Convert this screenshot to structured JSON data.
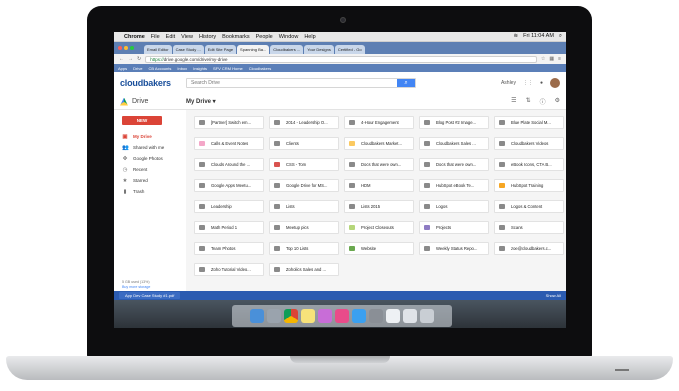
{
  "menubar": {
    "app": "Chrome",
    "items": [
      "File",
      "Edit",
      "View",
      "History",
      "Bookmarks",
      "People",
      "Window",
      "Help"
    ],
    "clock": "Fri 11:04 AM"
  },
  "tabs": [
    "Email Editor",
    "Case Study ...",
    "Edit Site Page",
    "Spanning Ba...",
    "Cloudbakers ...",
    "Your Designs",
    "Certified - Go"
  ],
  "address": {
    "scheme": "https://",
    "path": "drive.google.com/drive/my-drive"
  },
  "bookmarks": [
    "Apps",
    "Drive",
    "CB Accounts",
    "Inbox",
    "Insights",
    "SFV CRM Home",
    "Cloudbakers"
  ],
  "header": {
    "logo": "cloudbakers",
    "search_placeholder": "Search Drive",
    "account": "Ashley"
  },
  "subheader": {
    "product": "Drive",
    "location": "My Drive ▾"
  },
  "sidebar": {
    "new_label": "NEW",
    "items": [
      {
        "label": "My Drive",
        "icon": "drive-folder-icon"
      },
      {
        "label": "Shared with me",
        "icon": "people-icon"
      },
      {
        "label": "Google Photos",
        "icon": "pinwheel-icon"
      },
      {
        "label": "Recent",
        "icon": "clock-icon"
      },
      {
        "label": "Starred",
        "icon": "star-icon"
      },
      {
        "label": "Trash",
        "icon": "trash-icon"
      }
    ],
    "storage_used": "5 GB used (13%)",
    "storage_link": "Buy more storage"
  },
  "folders": [
    {
      "name": "[Partner] Switch em...",
      "color": "#8a8a8a"
    },
    {
      "name": "2014 - Leadership O...",
      "color": "#8a8a8a"
    },
    {
      "name": "4-Hour Engagement",
      "color": "#8a8a8a"
    },
    {
      "name": "Blog Post #2 Image...",
      "color": "#8a8a8a"
    },
    {
      "name": "Blue Plate Social M...",
      "color": "#8a8a8a"
    },
    {
      "name": "Calls & Event Notes",
      "color": "#f4a7c8"
    },
    {
      "name": "Clients",
      "color": "#8a8a8a"
    },
    {
      "name": "Cloudbakers Market...",
      "color": "#fbc960"
    },
    {
      "name": "Cloudbakers Sales ...",
      "color": "#8a8a8a"
    },
    {
      "name": "Cloudbakers Videos",
      "color": "#8a8a8a"
    },
    {
      "name": "Clouds Around the ...",
      "color": "#8a8a8a"
    },
    {
      "name": "CSS - Tom",
      "color": "#d9534f"
    },
    {
      "name": "Docs that were own...",
      "color": "#8a8a8a"
    },
    {
      "name": "Docs that were own...",
      "color": "#8a8a8a"
    },
    {
      "name": "eBook Icons, CTA B...",
      "color": "#8a8a8a"
    },
    {
      "name": "Google Apps Meetu...",
      "color": "#8a8a8a"
    },
    {
      "name": "Google Drive for MS...",
      "color": "#8a8a8a"
    },
    {
      "name": "HDM",
      "color": "#8a8a8a"
    },
    {
      "name": "HubSpot eBook Te...",
      "color": "#8a8a8a"
    },
    {
      "name": "HubSpot Training",
      "color": "#f6a623"
    },
    {
      "name": "Leadership",
      "color": "#8a8a8a"
    },
    {
      "name": "Lists",
      "color": "#8a8a8a"
    },
    {
      "name": "Lists 2015",
      "color": "#8a8a8a"
    },
    {
      "name": "Logos",
      "color": "#8a8a8a"
    },
    {
      "name": "Logos & Content",
      "color": "#8a8a8a"
    },
    {
      "name": "Math Period 1",
      "color": "#8a8a8a"
    },
    {
      "name": "Meetup pics",
      "color": "#8a8a8a"
    },
    {
      "name": "Project Closeouts",
      "color": "#b5d67a"
    },
    {
      "name": "Projects",
      "color": "#8e7cc3"
    },
    {
      "name": "Scans",
      "color": "#8a8a8a"
    },
    {
      "name": "Team Photos",
      "color": "#8a8a8a"
    },
    {
      "name": "Top 10 Lists",
      "color": "#8a8a8a"
    },
    {
      "name": "Website",
      "color": "#6aa84f"
    },
    {
      "name": "Weekly Status Repo...",
      "color": "#8a8a8a"
    },
    {
      "name": "zoe@cloudbakers.c...",
      "color": "#8a8a8a"
    },
    {
      "name": "Zoho Tutorial Video...",
      "color": "#8a8a8a"
    },
    {
      "name": "Zoholics Sales and ...",
      "color": "#8a8a8a"
    }
  ],
  "download_bar": {
    "file": "App Dev Case Study #1.pdf",
    "show_all": "Show All"
  }
}
